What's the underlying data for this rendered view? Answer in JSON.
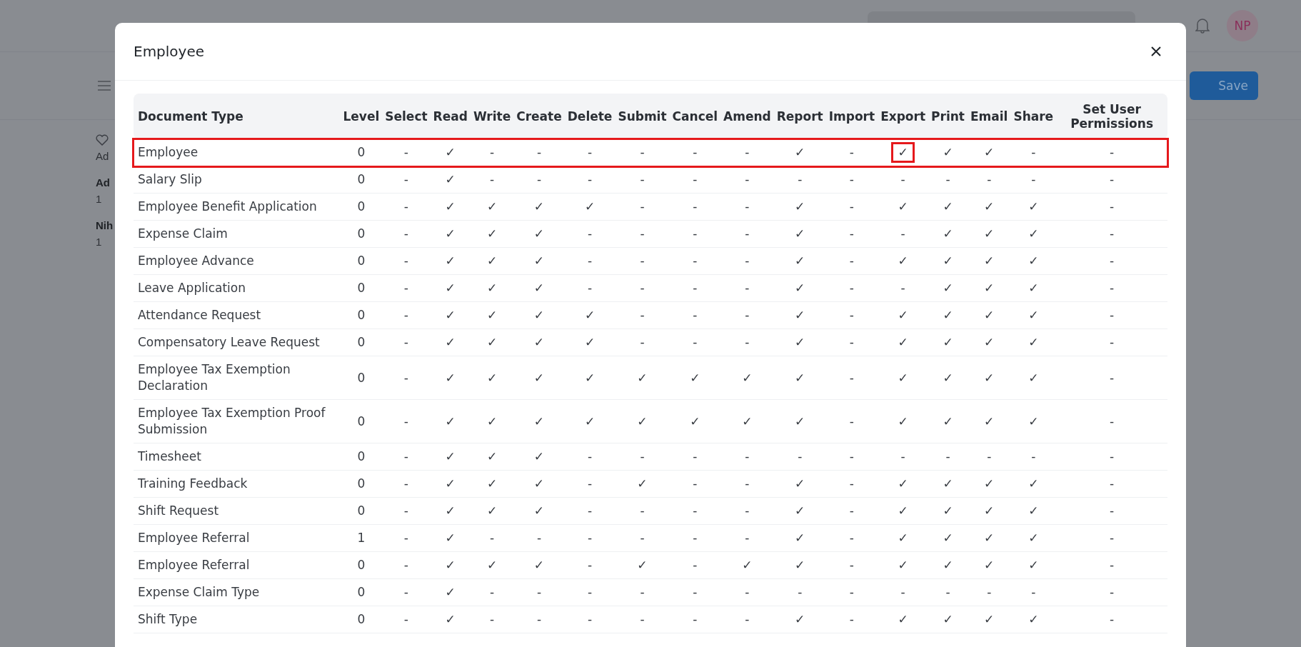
{
  "background": {
    "avatar": "NP",
    "save_button": "Save",
    "activity": [
      {
        "text": "Ad",
        "bold": false
      },
      {
        "text": "Ad",
        "bold": true
      },
      {
        "text": "1",
        "bold": false
      },
      {
        "text": "Nih",
        "bold": true
      },
      {
        "text": "1",
        "bold": false
      }
    ]
  },
  "dialog": {
    "title": "Employee",
    "table": {
      "columns": [
        "Document Type",
        "Level",
        "Select",
        "Read",
        "Write",
        "Create",
        "Delete",
        "Submit",
        "Cancel",
        "Amend",
        "Report",
        "Import",
        "Export",
        "Print",
        "Email",
        "Share",
        "Set User Permissions"
      ],
      "rows": [
        {
          "highlighted": true,
          "cells": [
            "Employee",
            "0",
            "-",
            "✓",
            "-",
            "-",
            "-",
            "-",
            "-",
            "-",
            "✓",
            "-",
            {
              "text": "✓",
              "highlighted": true
            },
            "✓",
            "✓",
            "-",
            "-"
          ]
        },
        {
          "highlighted": false,
          "cells": [
            "Salary Slip",
            "0",
            "-",
            "✓",
            "-",
            "-",
            "-",
            "-",
            "-",
            "-",
            "-",
            "-",
            "-",
            "-",
            "-",
            "-",
            "-"
          ]
        },
        {
          "highlighted": false,
          "cells": [
            "Employee Benefit Application",
            "0",
            "-",
            "✓",
            "✓",
            "✓",
            "✓",
            "-",
            "-",
            "-",
            "✓",
            "-",
            "✓",
            "✓",
            "✓",
            "✓",
            "-"
          ]
        },
        {
          "highlighted": false,
          "cells": [
            "Expense Claim",
            "0",
            "-",
            "✓",
            "✓",
            "✓",
            "-",
            "-",
            "-",
            "-",
            "✓",
            "-",
            "-",
            "✓",
            "✓",
            "✓",
            "-"
          ]
        },
        {
          "highlighted": false,
          "cells": [
            "Employee Advance",
            "0",
            "-",
            "✓",
            "✓",
            "✓",
            "-",
            "-",
            "-",
            "-",
            "✓",
            "-",
            "✓",
            "✓",
            "✓",
            "✓",
            "-"
          ]
        },
        {
          "highlighted": false,
          "cells": [
            "Leave Application",
            "0",
            "-",
            "✓",
            "✓",
            "✓",
            "-",
            "-",
            "-",
            "-",
            "✓",
            "-",
            "-",
            "✓",
            "✓",
            "✓",
            "-"
          ]
        },
        {
          "highlighted": false,
          "cells": [
            "Attendance Request",
            "0",
            "-",
            "✓",
            "✓",
            "✓",
            "✓",
            "-",
            "-",
            "-",
            "✓",
            "-",
            "✓",
            "✓",
            "✓",
            "✓",
            "-"
          ]
        },
        {
          "highlighted": false,
          "cells": [
            "Compensatory Leave Request",
            "0",
            "-",
            "✓",
            "✓",
            "✓",
            "✓",
            "-",
            "-",
            "-",
            "✓",
            "-",
            "✓",
            "✓",
            "✓",
            "✓",
            "-"
          ]
        },
        {
          "highlighted": false,
          "cells": [
            "Employee Tax Exemption Declaration",
            "0",
            "-",
            "✓",
            "✓",
            "✓",
            "✓",
            "✓",
            "✓",
            "✓",
            "✓",
            "-",
            "✓",
            "✓",
            "✓",
            "✓",
            "-"
          ]
        },
        {
          "highlighted": false,
          "cells": [
            "Employee Tax Exemption Proof Submission",
            "0",
            "-",
            "✓",
            "✓",
            "✓",
            "✓",
            "✓",
            "✓",
            "✓",
            "✓",
            "-",
            "✓",
            "✓",
            "✓",
            "✓",
            "-"
          ]
        },
        {
          "highlighted": false,
          "cells": [
            "Timesheet",
            "0",
            "-",
            "✓",
            "✓",
            "✓",
            "-",
            "-",
            "-",
            "-",
            "-",
            "-",
            "-",
            "-",
            "-",
            "-",
            "-"
          ]
        },
        {
          "highlighted": false,
          "cells": [
            "Training Feedback",
            "0",
            "-",
            "✓",
            "✓",
            "✓",
            "-",
            "✓",
            "-",
            "-",
            "✓",
            "-",
            "✓",
            "✓",
            "✓",
            "✓",
            "-"
          ]
        },
        {
          "highlighted": false,
          "cells": [
            "Shift Request",
            "0",
            "-",
            "✓",
            "✓",
            "✓",
            "-",
            "-",
            "-",
            "-",
            "✓",
            "-",
            "✓",
            "✓",
            "✓",
            "✓",
            "-"
          ]
        },
        {
          "highlighted": false,
          "cells": [
            "Employee Referral",
            "1",
            "-",
            "✓",
            "-",
            "-",
            "-",
            "-",
            "-",
            "-",
            "✓",
            "-",
            "✓",
            "✓",
            "✓",
            "✓",
            "-"
          ]
        },
        {
          "highlighted": false,
          "cells": [
            "Employee Referral",
            "0",
            "-",
            "✓",
            "✓",
            "✓",
            "-",
            "✓",
            "-",
            "✓",
            "✓",
            "-",
            "✓",
            "✓",
            "✓",
            "✓",
            "-"
          ]
        },
        {
          "highlighted": false,
          "cells": [
            "Expense Claim Type",
            "0",
            "-",
            "✓",
            "-",
            "-",
            "-",
            "-",
            "-",
            "-",
            "-",
            "-",
            "-",
            "-",
            "-",
            "-",
            "-"
          ]
        },
        {
          "highlighted": false,
          "cells": [
            "Shift Type",
            "0",
            "-",
            "✓",
            "-",
            "-",
            "-",
            "-",
            "-",
            "-",
            "✓",
            "-",
            "✓",
            "✓",
            "✓",
            "✓",
            "-"
          ]
        }
      ]
    }
  }
}
